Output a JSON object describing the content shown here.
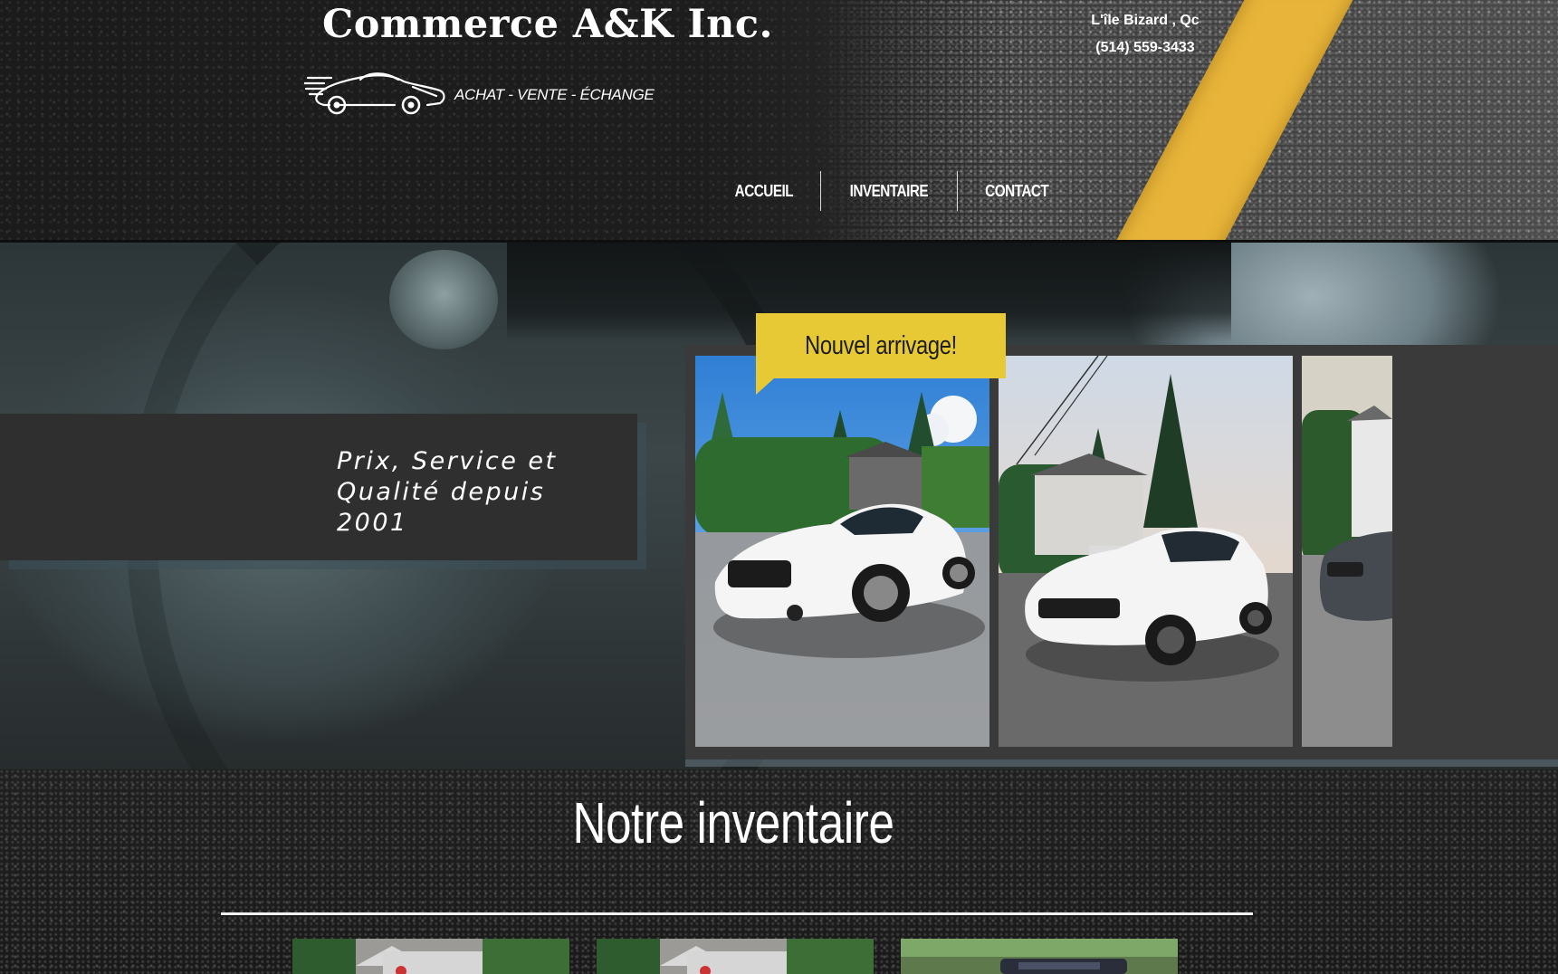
{
  "header": {
    "brand_title": "Commerce A&K Inc.",
    "tagline": "ACHAT - VENTE - ÉCHANGE",
    "location": "L'île Bizard , Qc",
    "phone": "(514) 559-3433",
    "logo_icon": "sports-car-icon",
    "road_line_color": "#e8b53a"
  },
  "nav": {
    "items": [
      {
        "label": "ACCUEIL"
      },
      {
        "label": "INVENTAIRE"
      },
      {
        "label": "CONTACT"
      }
    ]
  },
  "hero": {
    "slogan": "Prix, Service et Qualité depuis 2001",
    "badge": "Nouvel arrivage!",
    "badge_color": "#e7c936",
    "gallery": [
      {
        "icon": "white-coupe-photo"
      },
      {
        "icon": "white-suv-photo"
      },
      {
        "icon": "grey-sedan-photo"
      }
    ]
  },
  "inventory": {
    "title": "Notre inventaire",
    "thumbnails": [
      {
        "icon": "vehicle-photo"
      },
      {
        "icon": "vehicle-photo"
      },
      {
        "icon": "vehicle-photo"
      }
    ]
  }
}
